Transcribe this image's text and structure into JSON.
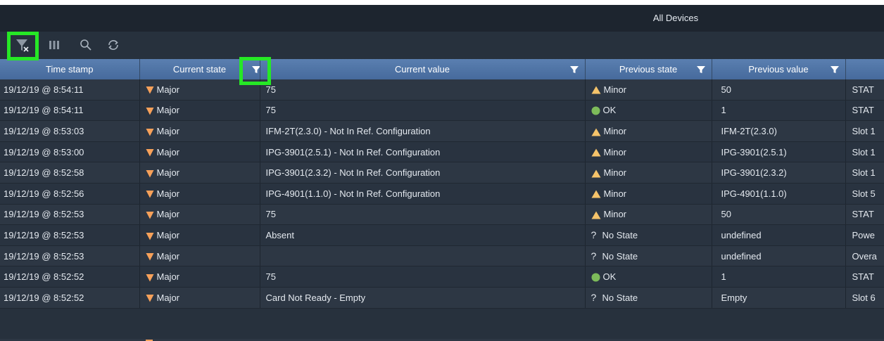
{
  "window": {
    "title": "All Devices"
  },
  "toolbar": {
    "buttons": [
      {
        "name": "clear-filters-icon"
      },
      {
        "name": "columns-icon"
      },
      {
        "name": "search-icon"
      },
      {
        "name": "refresh-icon"
      }
    ]
  },
  "columns": [
    "Time stamp",
    "Current state",
    "Current value",
    "Previous state",
    "Previous value",
    ""
  ],
  "rows": [
    {
      "time": "19/12/19 @ 8:54:11",
      "cur_state": "Major",
      "cur_value": "75",
      "prev_state": "Minor",
      "prev_icon": "minor",
      "prev_value": "50",
      "extra": "STAT"
    },
    {
      "time": "19/12/19 @ 8:54:11",
      "cur_state": "Major",
      "cur_value": "75",
      "prev_state": "OK",
      "prev_icon": "ok",
      "prev_value": "1",
      "extra": "STAT"
    },
    {
      "time": "19/12/19 @ 8:53:03",
      "cur_state": "Major",
      "cur_value": "IFM-2T(2.3.0) - Not In Ref. Configuration",
      "prev_state": "Minor",
      "prev_icon": "minor",
      "prev_value": "IFM-2T(2.3.0)",
      "extra": "Slot 1"
    },
    {
      "time": "19/12/19 @ 8:53:00",
      "cur_state": "Major",
      "cur_value": "IPG-3901(2.5.1) - Not In Ref. Configuration",
      "prev_state": "Minor",
      "prev_icon": "minor",
      "prev_value": "IPG-3901(2.5.1)",
      "extra": "Slot 1"
    },
    {
      "time": "19/12/19 @ 8:52:58",
      "cur_state": "Major",
      "cur_value": "IPG-3901(2.3.2) - Not In Ref. Configuration",
      "prev_state": "Minor",
      "prev_icon": "minor",
      "prev_value": "IPG-3901(2.3.2)",
      "extra": "Slot 1"
    },
    {
      "time": "19/12/19 @ 8:52:56",
      "cur_state": "Major",
      "cur_value": "IPG-4901(1.1.0) - Not In Ref. Configuration",
      "prev_state": "Minor",
      "prev_icon": "minor",
      "prev_value": "IPG-4901(1.1.0)",
      "extra": "Slot 5"
    },
    {
      "time": "19/12/19 @ 8:52:53",
      "cur_state": "Major",
      "cur_value": "75",
      "prev_state": "Minor",
      "prev_icon": "minor",
      "prev_value": "50",
      "extra": "STAT"
    },
    {
      "time": "19/12/19 @ 8:52:53",
      "cur_state": "Major",
      "cur_value": "Absent",
      "prev_state": "No State",
      "prev_icon": "nostate",
      "prev_value": "undefined",
      "extra": "Powe"
    },
    {
      "time": "19/12/19 @ 8:52:53",
      "cur_state": "Major",
      "cur_value": "",
      "prev_state": "No State",
      "prev_icon": "nostate",
      "prev_value": "undefined",
      "extra": "Overa"
    },
    {
      "time": "19/12/19 @ 8:52:52",
      "cur_state": "Major",
      "cur_value": "75",
      "prev_state": "OK",
      "prev_icon": "ok",
      "prev_value": "1",
      "extra": "STAT"
    },
    {
      "time": "19/12/19 @ 8:52:52",
      "cur_state": "Major",
      "cur_value": "Card Not Ready - Empty",
      "prev_state": "No State",
      "prev_icon": "nostate",
      "prev_value": "Empty",
      "extra": "Slot 6"
    }
  ],
  "colors": {
    "major": "#f7a15a",
    "minor": "#f5c36a",
    "ok": "#7dbb5a",
    "highlight": "#26e826"
  }
}
